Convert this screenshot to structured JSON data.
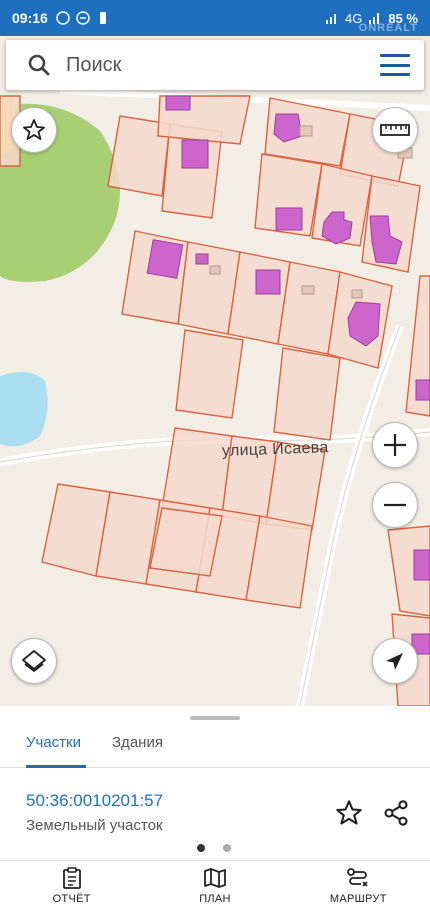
{
  "status_bar": {
    "time": "09:16",
    "network": "4G",
    "battery": "85 %",
    "watermark": "ONREALT"
  },
  "search": {
    "placeholder": "Поиск",
    "icon": "search-icon"
  },
  "map": {
    "street_name": "улица Исаева",
    "colors": {
      "parcel_fill": "#f6d8cc",
      "parcel_stroke": "#d9643f",
      "building_fill": "#cc66cc",
      "forest": "#a9cf74",
      "water": "#aadff2",
      "road": "#ffffff"
    }
  },
  "sheet": {
    "tabs": [
      {
        "label": "Участки",
        "active": true
      },
      {
        "label": "Здания",
        "active": false
      }
    ],
    "parcel_id": "50:36:0010201:57",
    "parcel_type": "Земельный участок",
    "page_indicator": {
      "count": 2,
      "current": 1
    }
  },
  "nav": {
    "items": [
      {
        "label": "ОТЧЁТ",
        "icon": "report-icon"
      },
      {
        "label": "ПЛАН",
        "icon": "map-plan-icon"
      },
      {
        "label": "МАРШРУТ",
        "icon": "route-icon"
      }
    ]
  }
}
